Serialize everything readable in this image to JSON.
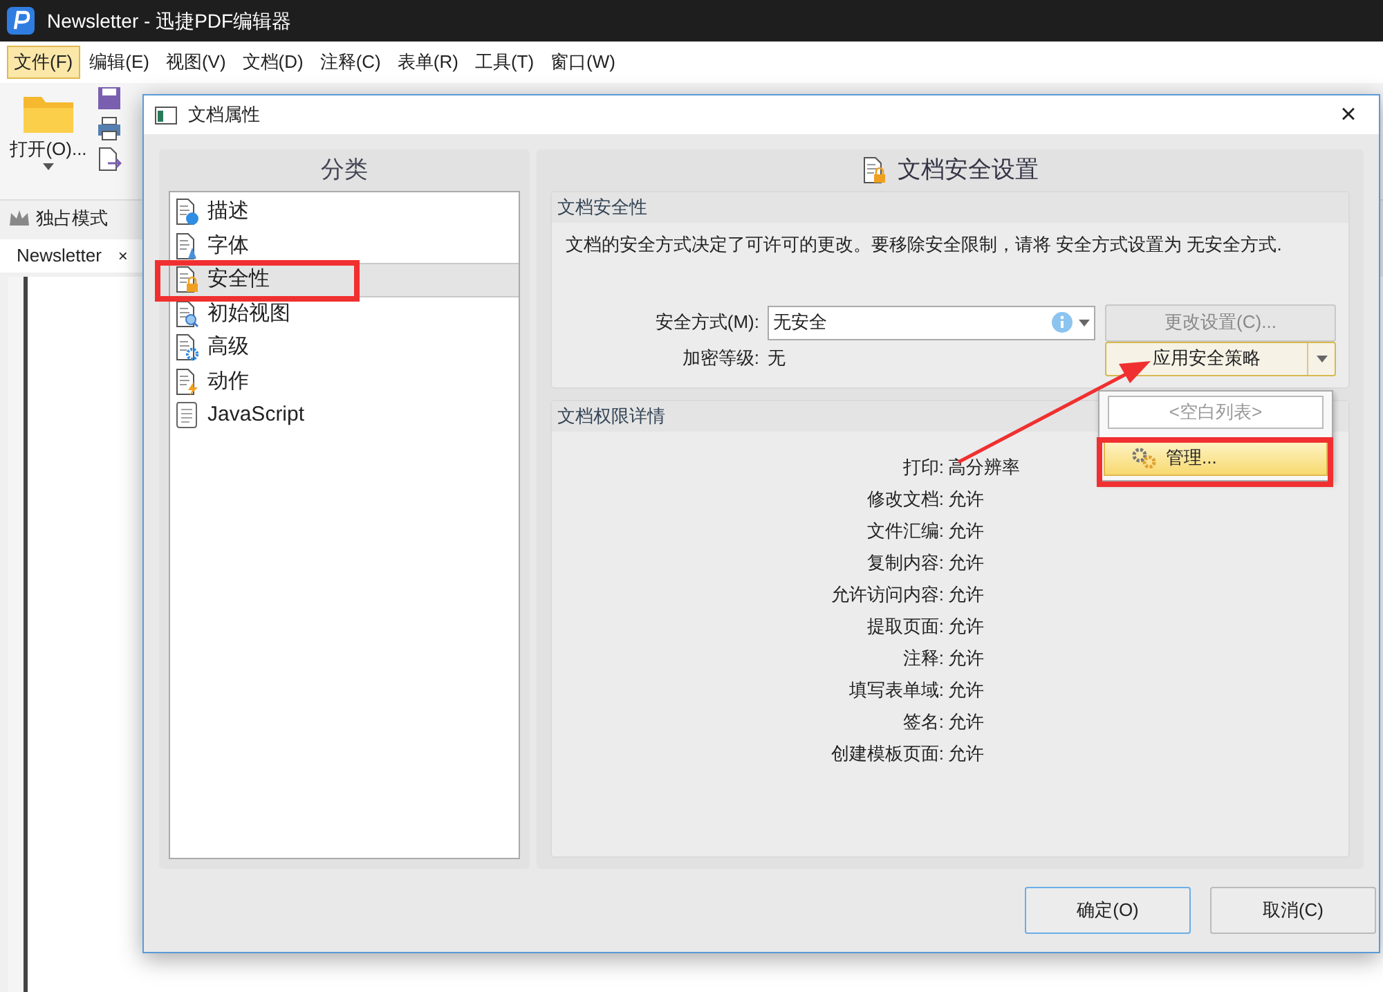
{
  "app": {
    "title": "Newsletter - 迅捷PDF编辑器",
    "menu": [
      {
        "label": "文件(F)",
        "selected": true
      },
      {
        "label": "编辑(E)",
        "selected": false
      },
      {
        "label": "视图(V)",
        "selected": false
      },
      {
        "label": "文档(D)",
        "selected": false
      },
      {
        "label": "注释(C)",
        "selected": false
      },
      {
        "label": "表单(R)",
        "selected": false
      },
      {
        "label": "工具(T)",
        "selected": false
      },
      {
        "label": "窗口(W)",
        "selected": false
      }
    ],
    "open_button": "打开(O)...",
    "exclusive_mode": "独占模式",
    "doc_tab": {
      "label": "Newsletter",
      "close": "×"
    }
  },
  "dialog": {
    "title": "文档属性",
    "close": "×",
    "category_header": "分类",
    "categories": [
      {
        "label": "描述",
        "kind": "info",
        "selected": false
      },
      {
        "label": "字体",
        "kind": "font",
        "selected": false
      },
      {
        "label": "安全性",
        "kind": "lock",
        "selected": true
      },
      {
        "label": "初始视图",
        "kind": "search",
        "selected": false
      },
      {
        "label": "高级",
        "kind": "gear",
        "selected": false
      },
      {
        "label": "动作",
        "kind": "bolt",
        "selected": false
      },
      {
        "label": "JavaScript",
        "kind": "script",
        "selected": false
      }
    ],
    "section_title": "文档安全设置",
    "security_group": {
      "title": "文档安全性",
      "description": "文档的安全方式决定了可许可的更改。要移除安全限制，请将 安全方式设置为 无安全方式.",
      "method_label": "安全方式(M):",
      "method_value": "无安全",
      "change_button": {
        "label": "更改设置(C)...",
        "disabled": true
      },
      "level_label": "加密等级:",
      "level_value": "无",
      "apply_button": "应用安全策略",
      "menu": [
        {
          "label": "<空白列表>",
          "kind": "empty"
        },
        {
          "label": "管理...",
          "kind": "item"
        }
      ]
    },
    "permissions_group": {
      "title": "文档权限详情",
      "rows": [
        {
          "label": "打印:",
          "value": "高分辨率"
        },
        {
          "label": "修改文档:",
          "value": "允许"
        },
        {
          "label": "文件汇编:",
          "value": "允许"
        },
        {
          "label": "复制内容:",
          "value": "允许"
        },
        {
          "label": "允许访问内容:",
          "value": "允许"
        },
        {
          "label": "提取页面:",
          "value": "允许"
        },
        {
          "label": "注释:",
          "value": "允许"
        },
        {
          "label": "填写表单域:",
          "value": "允许"
        },
        {
          "label": "签名:",
          "value": "允许"
        },
        {
          "label": "创建模板页面:",
          "value": "允许"
        }
      ]
    },
    "buttons": [
      "确定(O)",
      "取消(C)"
    ]
  }
}
